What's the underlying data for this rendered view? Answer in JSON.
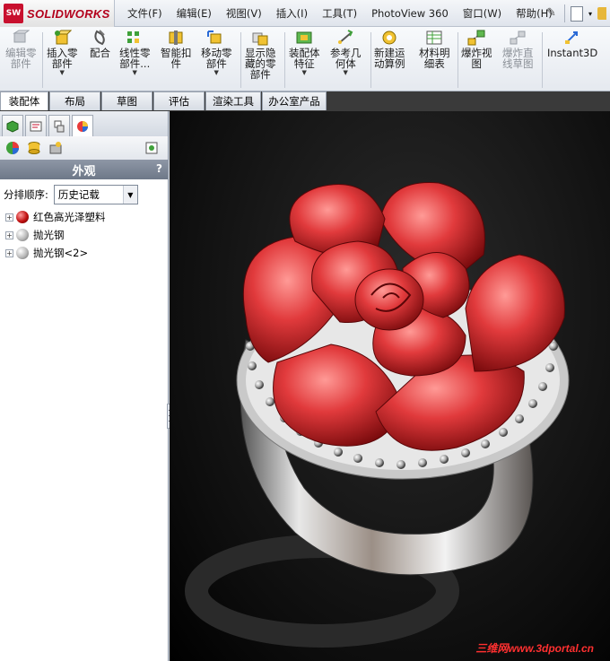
{
  "app": {
    "brand": "SOLIDWORKS",
    "logo_mark": "SW"
  },
  "menu": {
    "items": [
      "文件(F)",
      "编辑(E)",
      "视图(V)",
      "插入(I)",
      "工具(T)",
      "PhotoView 360",
      "窗口(W)",
      "帮助(H)"
    ]
  },
  "ribbon": {
    "tools": [
      {
        "label1": "编辑零",
        "label2": "部件",
        "enabled": false,
        "icon": "edit-component-icon"
      },
      {
        "label1": "插入零",
        "label2": "部件",
        "enabled": true,
        "dropdown": true,
        "icon": "insert-component-icon"
      },
      {
        "label1": "配合",
        "label2": "",
        "enabled": true,
        "icon": "mate-icon"
      },
      {
        "label1": "线性零",
        "label2": "部件...",
        "enabled": true,
        "dropdown": true,
        "icon": "linear-pattern-icon"
      },
      {
        "label1": "智能扣",
        "label2": "件",
        "enabled": true,
        "icon": "smart-fastener-icon"
      },
      {
        "label1": "移动零",
        "label2": "部件",
        "enabled": true,
        "dropdown": true,
        "icon": "move-component-icon"
      },
      {
        "label1": "显示隐",
        "label2": "藏的零",
        "label3": "部件",
        "enabled": true,
        "icon": "show-hidden-icon"
      },
      {
        "label1": "装配体",
        "label2": "特征",
        "enabled": true,
        "dropdown": true,
        "icon": "assembly-feature-icon"
      },
      {
        "label1": "参考几",
        "label2": "何体",
        "enabled": true,
        "dropdown": true,
        "icon": "reference-geometry-icon"
      },
      {
        "label1": "新建运",
        "label2": "动算例",
        "enabled": true,
        "icon": "new-motion-study-icon"
      },
      {
        "label1": "材料明",
        "label2": "细表",
        "enabled": true,
        "icon": "bom-icon"
      },
      {
        "label1": "爆炸视",
        "label2": "图",
        "enabled": true,
        "icon": "exploded-view-icon"
      },
      {
        "label1": "爆炸直",
        "label2": "线草图",
        "enabled": false,
        "icon": "explode-line-sketch-icon"
      },
      {
        "label1": "Instant3D",
        "label2": "",
        "enabled": true,
        "icon": "instant3d-icon"
      }
    ]
  },
  "tabs": {
    "items": [
      "装配体",
      "布局",
      "草图",
      "评估",
      "渲染工具",
      "办公室产品"
    ],
    "active": "装配体"
  },
  "panel": {
    "title": "外观",
    "help": "?",
    "sort_label": "分排顺序:",
    "sort_value": "历史记载",
    "tree": [
      {
        "label": "红色高光泽塑料",
        "color": "#c01010"
      },
      {
        "label": "抛光钢",
        "color": "#b8b8b8"
      },
      {
        "label": "抛光钢<2>",
        "color": "#b8b8b8"
      }
    ]
  },
  "viewport": {
    "watermark": "三维网www.3dportal.cn"
  },
  "colors": {
    "rose": "#e13a3c",
    "steel": "#c9c9c9",
    "viewport_bg": "#141414"
  }
}
